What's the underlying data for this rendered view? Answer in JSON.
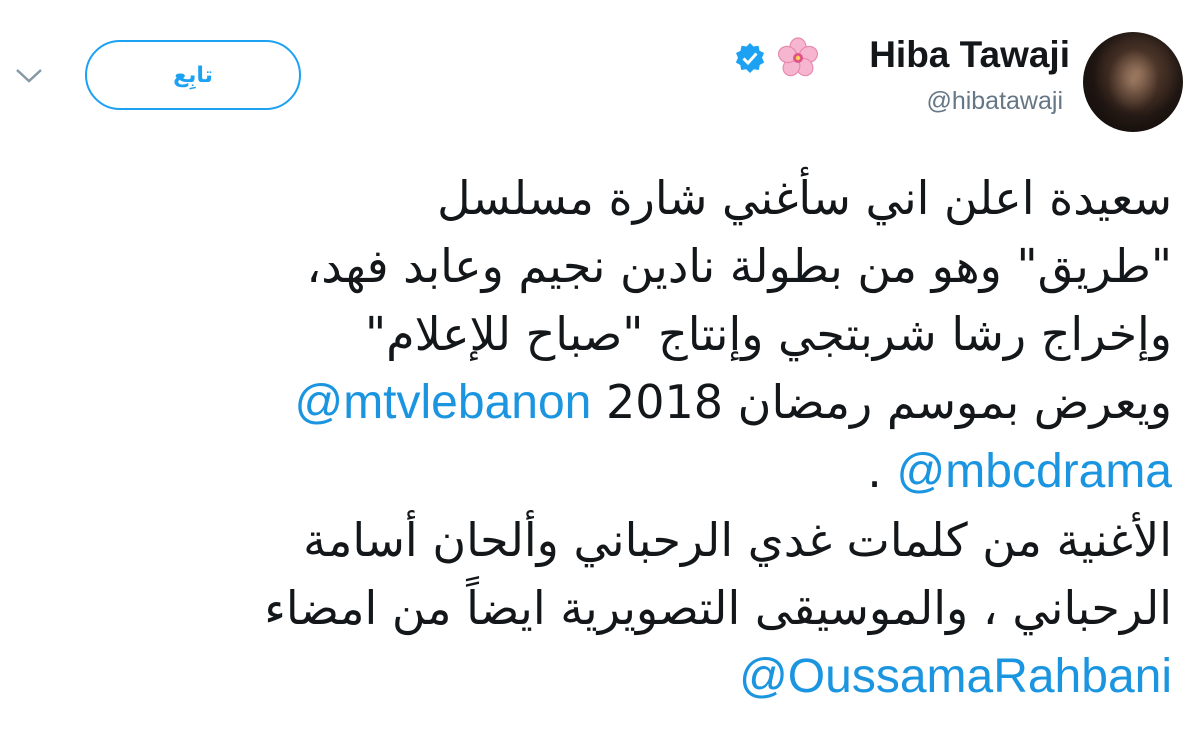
{
  "user": {
    "display_name": "Hiba Tawaji",
    "handle": "@hibatawaji",
    "name_emoji": "cherry-blossom-icon",
    "verified": true
  },
  "actions": {
    "follow_label": "تابِع"
  },
  "tweet": {
    "line1": "سعيدة اعلن اني سأغني شارة مسلسل",
    "line2": "\"طريق\" وهو من بطولة نادين نجيم وعابد فهد،",
    "line3": "وإخراج رشا شربتجي وإنتاج \"صباح للإعلام\"",
    "line4_text": "ويعرض بموسم رمضان 2018",
    "line4_mention": "@mtvlebanon",
    "line5_mention": "@mbcdrama",
    "line5_text": ".",
    "line6": "الأغنية من كلمات غدي الرحباني وألحان أسامة",
    "line7": "الرحباني ، والموسيقى التصويرية ايضاً من امضاء",
    "line8_mention": "@OussamaRahbani"
  },
  "colors": {
    "link": "#1b95e0",
    "follow_border": "#1da1f2",
    "secondary_text": "#657786"
  }
}
